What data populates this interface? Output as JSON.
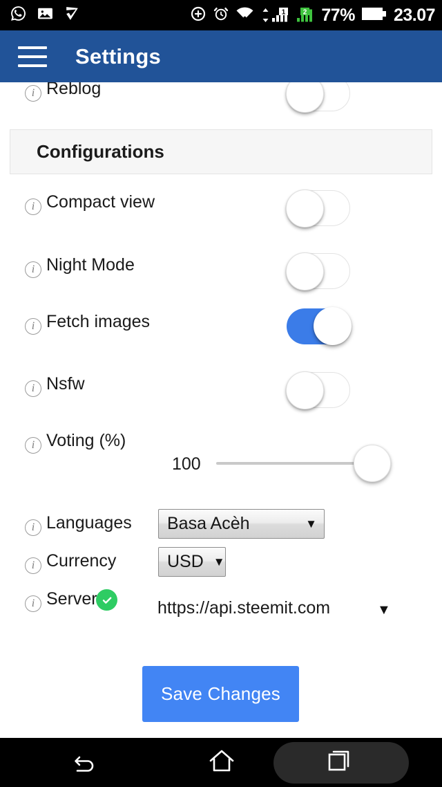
{
  "status_bar": {
    "left_icons": [
      "whatsapp-icon",
      "gallery-icon",
      "checkmark-flag-icon"
    ],
    "right_icons": [
      "dnd-plus-icon",
      "alarm-icon",
      "wifi-icon",
      "mobile-data-sim1-icon",
      "mobile-data-sim2-icon"
    ],
    "sim1_label": "1",
    "sim2_label": "2",
    "battery_percent": "77%",
    "time": "23.07"
  },
  "appbar": {
    "menu_icon": "hamburger-menu-icon",
    "title": "Settings",
    "background_color": "#215398"
  },
  "settings": {
    "reblog": {
      "label": "Reblog",
      "info_icon": "i",
      "toggle_state": "off"
    },
    "section_header": "Configurations",
    "items": [
      {
        "label": "Compact view",
        "info_icon": "i",
        "toggle_state": "off"
      },
      {
        "label": "Night Mode",
        "info_icon": "i",
        "toggle_state": "off"
      },
      {
        "label": "Fetch images",
        "info_icon": "i",
        "toggle_state": "on"
      },
      {
        "label": "Nsfw",
        "info_icon": "i",
        "toggle_state": "off"
      }
    ],
    "voting": {
      "label": "Voting (%)",
      "info_icon": "i",
      "value": "100",
      "min": 0,
      "max": 100,
      "percent": 100
    },
    "languages": {
      "label": "Languages",
      "info_icon": "i",
      "selected": "Basa Acèh",
      "caret": "▼"
    },
    "currency": {
      "label": "Currency",
      "info_icon": "i",
      "selected": "USD",
      "caret": "▼"
    },
    "server": {
      "label": "Server",
      "info_icon": "i",
      "status_icon": "green-check-badge",
      "value": "https://api.steemit.com",
      "caret": "▼"
    }
  },
  "actions": {
    "save_label": "Save Changes",
    "save_color": "#4285f4"
  },
  "navbar": {
    "back_icon": "back-arrow-icon",
    "home_icon": "home-icon",
    "recents_icon": "recents-icon"
  },
  "colors": {
    "accent_blue": "#3b7ce8",
    "appbar_blue": "#215398",
    "success_green": "#2ecc63",
    "section_gray": "#f6f6f6"
  }
}
